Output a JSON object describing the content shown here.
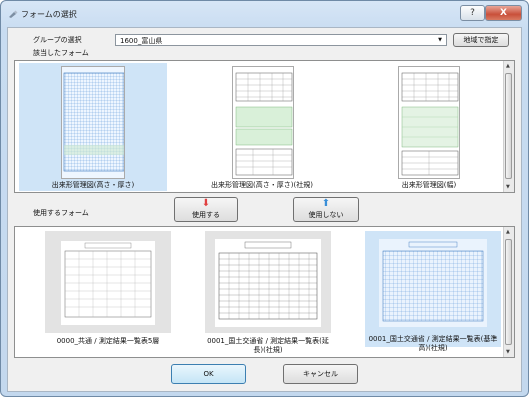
{
  "window": {
    "title": "フォームの選択",
    "help": "?",
    "close": "X"
  },
  "group": {
    "label": "グループの選択",
    "value": "1600_富山県",
    "button": "地域で指定"
  },
  "available": {
    "label": "該当したフォーム",
    "items": [
      {
        "caption": "出来形管理図(高さ・厚さ)"
      },
      {
        "caption": "出来形管理図(高さ・厚さ)(社規)"
      },
      {
        "caption": "出来形管理図(幅)"
      }
    ]
  },
  "used": {
    "label": "使用するフォーム",
    "add_button": "使用する",
    "remove_button": "使用しない",
    "items": [
      {
        "caption": "0000_共通 / 測定結果一覧表5層"
      },
      {
        "caption": "0001_国土交通省 / 測定結果一覧表(延長)(社規)"
      },
      {
        "caption": "0001_国土交通省 / 測定結果一覧表(基準高)(社規)"
      }
    ]
  },
  "footer": {
    "ok": "OK",
    "cancel": "キャンセル"
  },
  "colors": {
    "add_arrow": "#e04040",
    "remove_arrow": "#3a8fd8",
    "selection": "#cfe4f7"
  },
  "icons": {
    "add": "down-arrow-icon",
    "remove": "up-arrow-icon"
  }
}
